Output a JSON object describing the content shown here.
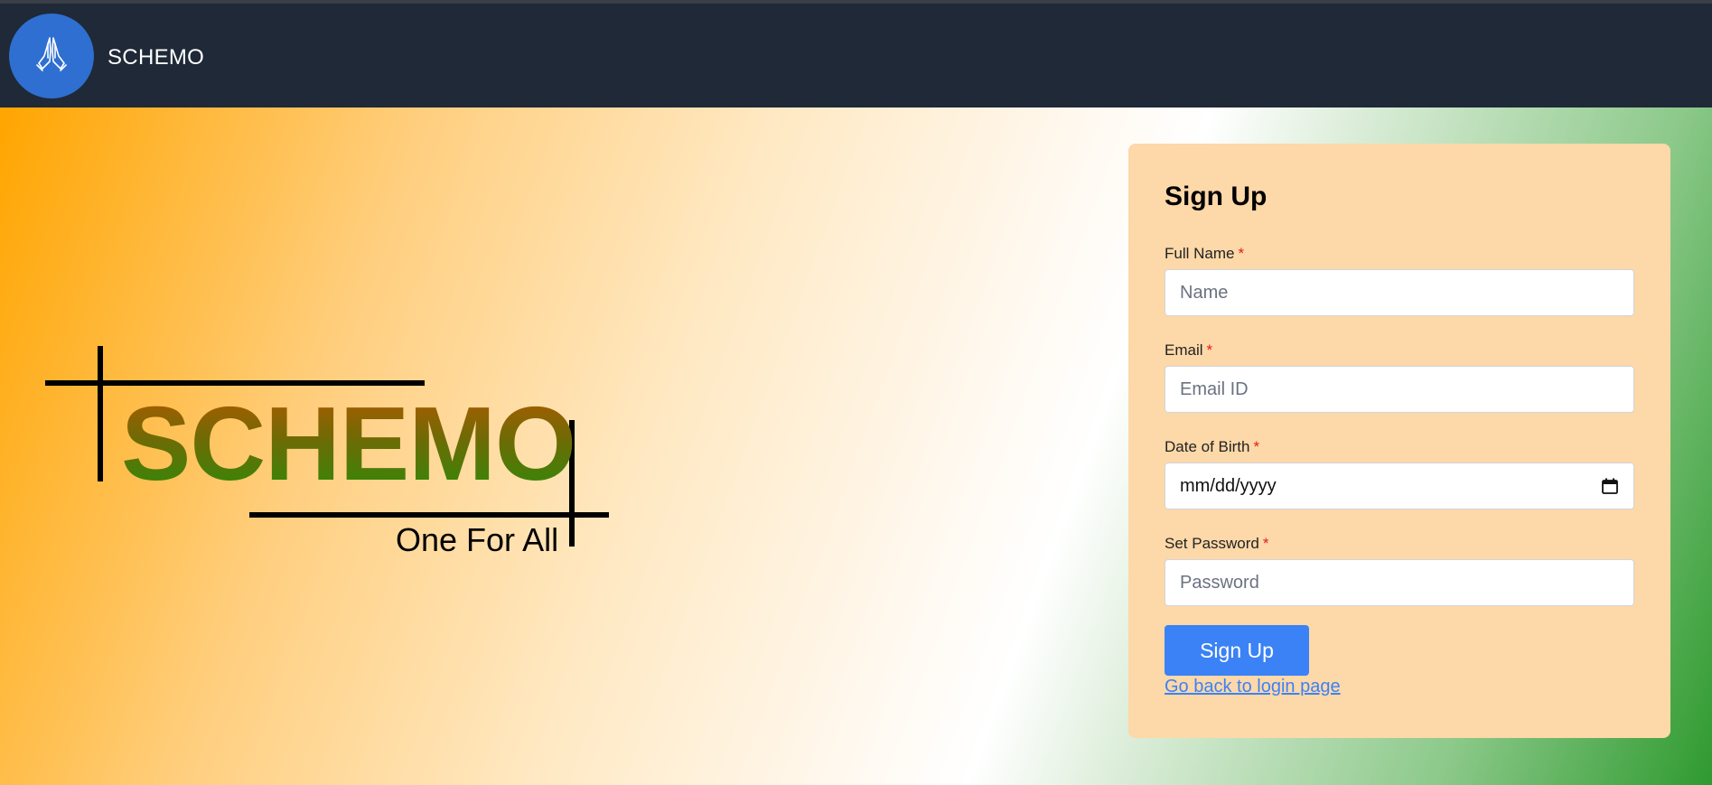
{
  "navbar": {
    "brand": "SCHEMO",
    "logo_icon": "praying-hands-icon"
  },
  "emblem": {
    "title": "SCHEMO",
    "tagline": "One For All"
  },
  "form": {
    "title": "Sign Up",
    "required_mark": "*",
    "fields": {
      "name": {
        "label": "Full Name",
        "placeholder": "Name"
      },
      "email": {
        "label": "Email",
        "placeholder": "Email ID"
      },
      "dob": {
        "label": "Date of Birth",
        "value": "mm/dd/yyyy",
        "icon": "calendar-icon"
      },
      "password": {
        "label": "Set Password",
        "placeholder": "Password"
      }
    },
    "submit_label": "Sign Up",
    "login_link": "Go back to login page"
  },
  "colors": {
    "navbar_bg": "#1f2937",
    "logo_bg": "#2f6fd1",
    "card_bg": "#fdd8a8",
    "button_bg": "#3b82f6",
    "required": "#e11d1d",
    "saffron": "#ffa500",
    "green": "#2f9a2f"
  }
}
